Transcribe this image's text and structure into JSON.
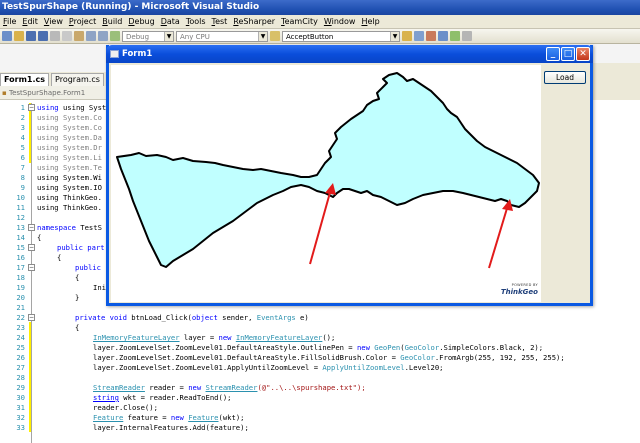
{
  "window": {
    "title": "TestSpurShape (Running) - Microsoft Visual Studio"
  },
  "menu": [
    "File",
    "Edit",
    "View",
    "Project",
    "Build",
    "Debug",
    "Data",
    "Tools",
    "Test",
    "ReSharper",
    "TeamCity",
    "Window",
    "Help"
  ],
  "toolbar": {
    "config_combo": "Debug",
    "platform_combo": "Any CPU",
    "find_combo": "AcceptButton"
  },
  "tabs": [
    {
      "label": "Form1.cs"
    },
    {
      "label": "Program.cs"
    }
  ],
  "navbar": {
    "class_combo": "TestSpurShape.Form1"
  },
  "form1": {
    "title": "Form1",
    "load_button": "Load",
    "powered_by": "POWERED BY",
    "logo": "ThinkGeo"
  },
  "colors": {
    "polygon_fill": "#C0FFFF",
    "arrow": "#E21B1B",
    "keyword": "#0000FF",
    "type": "#2B91AF",
    "string": "#A31515"
  },
  "code": {
    "line_numbers": [
      "1",
      "2",
      "3",
      "4",
      "5",
      "6",
      "7",
      "8",
      "9",
      "10",
      "11",
      "12",
      "13",
      "14",
      "15",
      "16",
      "17",
      "18",
      "19",
      "20",
      "21",
      "22",
      "23",
      "24",
      "25",
      "26",
      "27",
      "28",
      "29",
      "30",
      "31",
      "32",
      "33"
    ],
    "l1": "using System;",
    "l2": "using System.Co",
    "l3": "using System.Co",
    "l4": "using System.Da",
    "l5": "using System.Dr",
    "l6": "using System.Li",
    "l7": "using System.Te",
    "l8": "using System.Wi",
    "l9": "using System.IO",
    "l10": "using ThinkGeo.",
    "l11": "using ThinkGeo.",
    "l13_kw": "namespace",
    "l13_rest": " TestS",
    "l14": "{",
    "l15_kw": "public part",
    "l16": "{",
    "l17_kw": "public",
    "l18": "{",
    "l19": "Ini",
    "l20": "}",
    "l22_kw": "private void",
    "l22_mid": " btnLoad_Click(",
    "l22_kw2": "object",
    "l22_mid2": " sender, ",
    "l22_ty": "EventArgs",
    "l22_end": " e)",
    "l23": "{",
    "l24_ty": "InMemoryFeatureLayer",
    "l24_mid": " layer = ",
    "l24_kw": "new",
    "l24_ty2": "InMemoryFeatureLayer",
    "l24_end": "();",
    "l25_a": "layer.ZoomLevelSet.ZoomLevel01.DefaultAreaStyle.OutlinePen = ",
    "l25_kw": "new",
    "l25_b": "GeoPen",
    "l25_c": "(",
    "l25_d": "GeoColor",
    "l25_e": ".SimpleColors.Black, 2);",
    "l26_a": "layer.ZoomLevelSet.ZoomLevel01.DefaultAreaStyle.FillSolidBrush.Color = ",
    "l26_b": "GeoColor",
    "l26_c": ".FromArgb(255, 192, 255, 255);",
    "l27_a": "layer.ZoomLevelSet.ZoomLevel01.ApplyUntilZoomLevel = ",
    "l27_b": "ApplyUntilZoomLevel",
    "l27_c": ".Level20;",
    "l29_ty": "StreamReader",
    "l29_mid": " reader = ",
    "l29_kw": "new",
    "l29_ty2": "StreamReader",
    "l29_str": "(@\"..\\..\\spurshape.txt\");",
    "l30_ty": "string",
    "l30_rest": " wkt = reader.ReadToEnd();",
    "l31": "reader.Close();",
    "l32_ty": "Feature",
    "l32_mid": " feature = ",
    "l32_kw": "new",
    "l32_ty2": "Feature",
    "l32_end": "(wkt);",
    "l33": "layer.InternalFeatures.Add(feature);"
  }
}
